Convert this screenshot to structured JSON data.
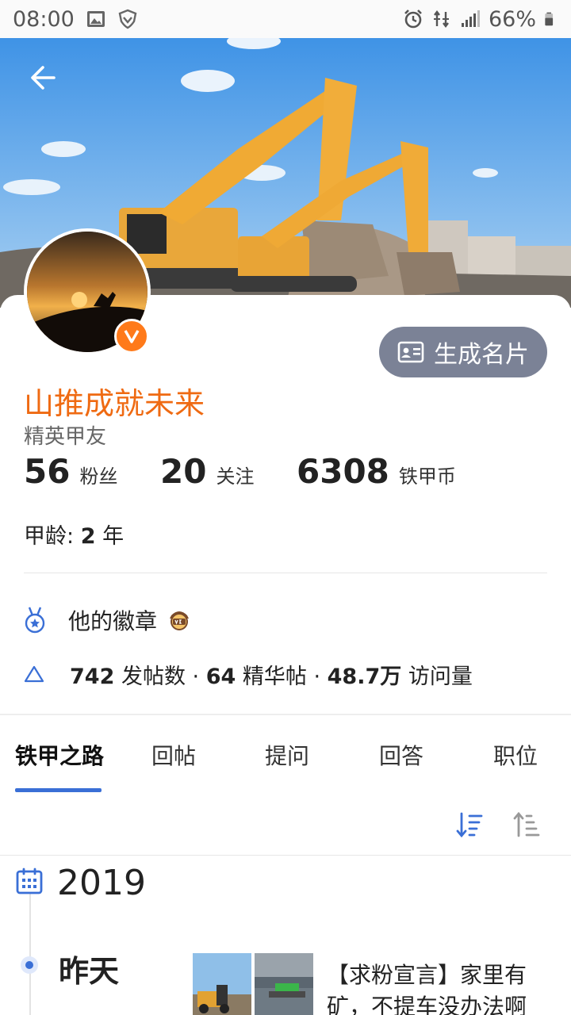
{
  "status_bar": {
    "time": "08:00",
    "battery": "66%"
  },
  "profile": {
    "username": "山推成就未来",
    "title": "精英甲友",
    "card_button": "生成名片",
    "stats": [
      {
        "value": "56",
        "label": "粉丝"
      },
      {
        "value": "20",
        "label": "关注"
      },
      {
        "value": "6308",
        "label": "铁甲币"
      }
    ],
    "age_label": "甲龄: ",
    "age_value": "2",
    "age_unit": " 年",
    "badges_label": "他的徽章",
    "posts": {
      "count": "742",
      "count_label": " 发帖数 · ",
      "essence": "64",
      "essence_label": " 精华帖 · ",
      "visits": "48.7万",
      "visits_label": " 访问量"
    }
  },
  "tabs": [
    "铁甲之路",
    "回帖",
    "提问",
    "回答",
    "职位"
  ],
  "timeline": {
    "year": "2019",
    "day": "昨天",
    "post_title": "【求粉宣言】家里有矿，不提车没办法啊"
  },
  "colors": {
    "accent": "#3a6fd6",
    "username": "#ef6a12",
    "card_button_bg": "#7b8296",
    "vip_badge": "#ff7a1a"
  }
}
